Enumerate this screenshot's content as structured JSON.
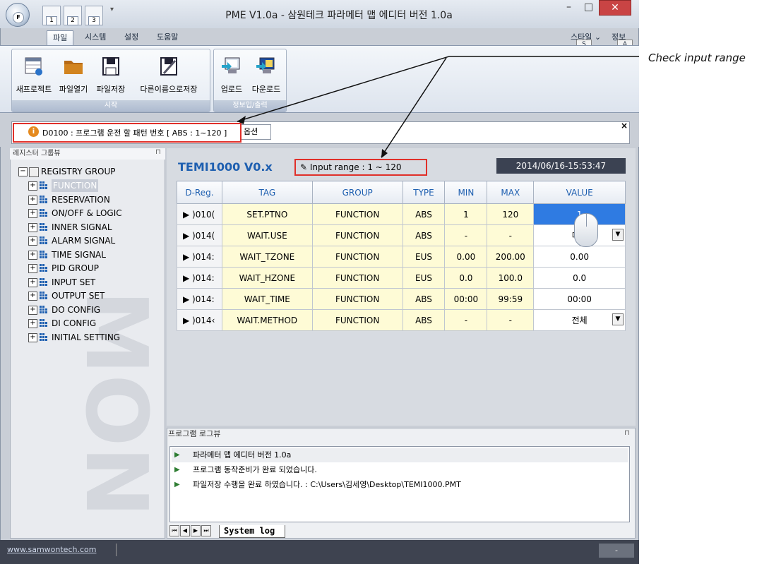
{
  "window": {
    "title": "PME V1.0a - 삼원테크 파라메터 맵 에디터 버전 1.0a",
    "orb_letter": "F",
    "qat_keytips": [
      "1",
      "2",
      "3"
    ],
    "controls": {
      "minimize": "–",
      "maximize": "□",
      "close": "✕"
    }
  },
  "ribbon": {
    "tabs": [
      "파일",
      "시스템",
      "설정",
      "도움말"
    ],
    "active_tab": 0,
    "style_menu": "스타일",
    "style_menu_key": "S",
    "info_menu": "정보",
    "info_menu_key": "A",
    "groups": [
      {
        "label": "시작",
        "buttons": [
          {
            "label": "새프로젝트",
            "icon": "new-project-icon"
          },
          {
            "label": "파일열기",
            "icon": "folder-icon"
          },
          {
            "label": "파일저장",
            "icon": "save-icon"
          },
          {
            "label": "다른이름으로저장",
            "icon": "save-as-icon"
          }
        ]
      },
      {
        "label": "정보입/출력",
        "buttons": [
          {
            "label": "업로드",
            "icon": "upload-icon"
          },
          {
            "label": "다운로드",
            "icon": "download-icon"
          }
        ]
      }
    ]
  },
  "infobar": {
    "message": "D0100 : 프로그램 운전 할 패턴 번호 [ ABS : 1~120 ]",
    "option_label": "옵션",
    "close": "×"
  },
  "tree": {
    "header": "레지스터 그룹뷰",
    "root": "REGISTRY GROUP",
    "items": [
      "FUNCTION",
      "RESERVATION",
      "ON/OFF & LOGIC",
      "INNER SIGNAL",
      "ALARM SIGNAL",
      "TIME SIGNAL",
      "PID GROUP",
      "INPUT SET",
      "OUTPUT SET",
      "DO CONFIG",
      "DI CONFIG",
      "INITIAL SETTING"
    ],
    "selected_index": 0
  },
  "main": {
    "model_title": "TEMI1000 V0.x",
    "input_range": "Input range : 1 ~ 120",
    "timestamp": "2014/06/16-15:53:47",
    "table": {
      "headers": [
        "D-Reg.",
        "TAG",
        "GROUP",
        "TYPE",
        "MIN",
        "MAX",
        "VALUE"
      ],
      "rows": [
        {
          "dreg": "▶  )010(",
          "tag": "SET.PTNO",
          "group": "FUNCTION",
          "type": "ABS",
          "min": "1",
          "max": "120",
          "value": "1"
        },
        {
          "dreg": "▶  )014(",
          "tag": "WAIT.USE",
          "group": "FUNCTION",
          "type": "ABS",
          "min": "-",
          "max": "-",
          "value": "미사"
        },
        {
          "dreg": "▶  )014:",
          "tag": "WAIT_TZONE",
          "group": "FUNCTION",
          "type": "EUS",
          "min": "0.00",
          "max": "200.00",
          "value": "0.00"
        },
        {
          "dreg": "▶  )014:",
          "tag": "WAIT_HZONE",
          "group": "FUNCTION",
          "type": "EUS",
          "min": "0.0",
          "max": "100.0",
          "value": "0.0"
        },
        {
          "dreg": "▶  )014:",
          "tag": "WAIT_TIME",
          "group": "FUNCTION",
          "type": "ABS",
          "min": "00:00",
          "max": "99:59",
          "value": "00:00"
        },
        {
          "dreg": "▶  )014‹",
          "tag": "WAIT.METHOD",
          "group": "FUNCTION",
          "type": "ABS",
          "min": "-",
          "max": "-",
          "value": "전체"
        }
      ]
    }
  },
  "log": {
    "header": "프로그램 로그뷰",
    "entries": [
      "파라메터 맵 에디터 버전 1.0a",
      "프로그램 동작준비가 완료 되었습니다.",
      "파일저장 수행을 완료 하였습니다. : C:\\Users\\김세영\\Desktop\\TEMI1000.PMT"
    ],
    "tab_label": "System log"
  },
  "statusbar": {
    "link": "www.samwontech.com",
    "right": "-"
  },
  "annotation": {
    "label": "Check input range",
    "color": "#e0302a"
  }
}
